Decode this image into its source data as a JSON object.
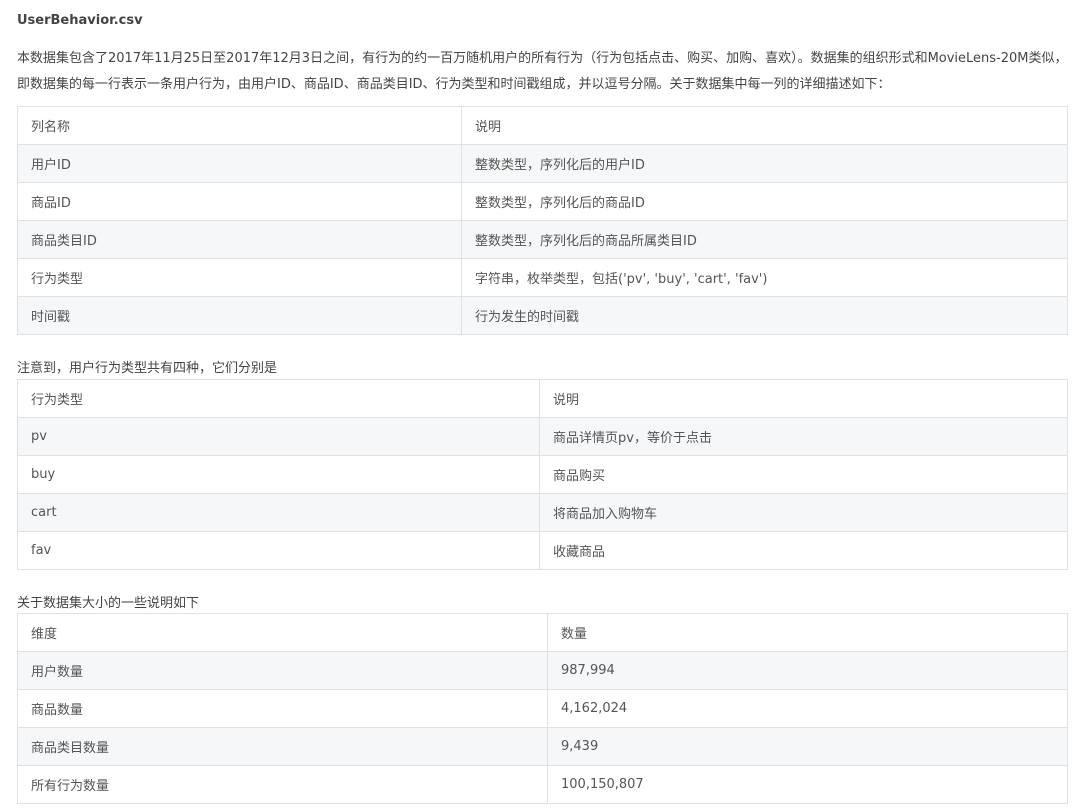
{
  "file_title": "UserBehavior.csv",
  "intro": {
    "line1": "本数据集包含了2017年11月25日至2017年12月3日之间，有行为的约一百万随机用户的所有行为（行为包括点击、购买、加购、喜欢）。数据集的组织形式和MovieLens-20M类似，",
    "line2": "即数据集的每一行表示一条用户行为，由用户ID、商品ID、商品类目ID、行为类型和时间戳组成，并以逗号分隔。关于数据集中每一列的详细描述如下："
  },
  "table1": {
    "headers": [
      "列名称",
      "说明"
    ],
    "rows": [
      [
        "用户ID",
        "整数类型，序列化后的用户ID"
      ],
      [
        "商品ID",
        "整数类型，序列化后的商品ID"
      ],
      [
        "商品类目ID",
        "整数类型，序列化后的商品所属类目ID"
      ],
      [
        "行为类型",
        "字符串，枚举类型，包括('pv', 'buy', 'cart', 'fav')"
      ],
      [
        "时间戳",
        "行为发生的时间戳"
      ]
    ]
  },
  "note2": "注意到，用户行为类型共有四种，它们分别是",
  "table2": {
    "headers": [
      "行为类型",
      "说明"
    ],
    "rows": [
      [
        "pv",
        "商品详情页pv，等价于点击"
      ],
      [
        "buy",
        "商品购买"
      ],
      [
        "cart",
        "将商品加入购物车"
      ],
      [
        "fav",
        "收藏商品"
      ]
    ]
  },
  "note3": "关于数据集大小的一些说明如下",
  "table3": {
    "headers": [
      "维度",
      "数量"
    ],
    "rows": [
      [
        "用户数量",
        "987,994"
      ],
      [
        "商品数量",
        "4,162,024"
      ],
      [
        "商品类目数量",
        "9,439"
      ],
      [
        "所有行为数量",
        "100,150,807"
      ]
    ]
  }
}
